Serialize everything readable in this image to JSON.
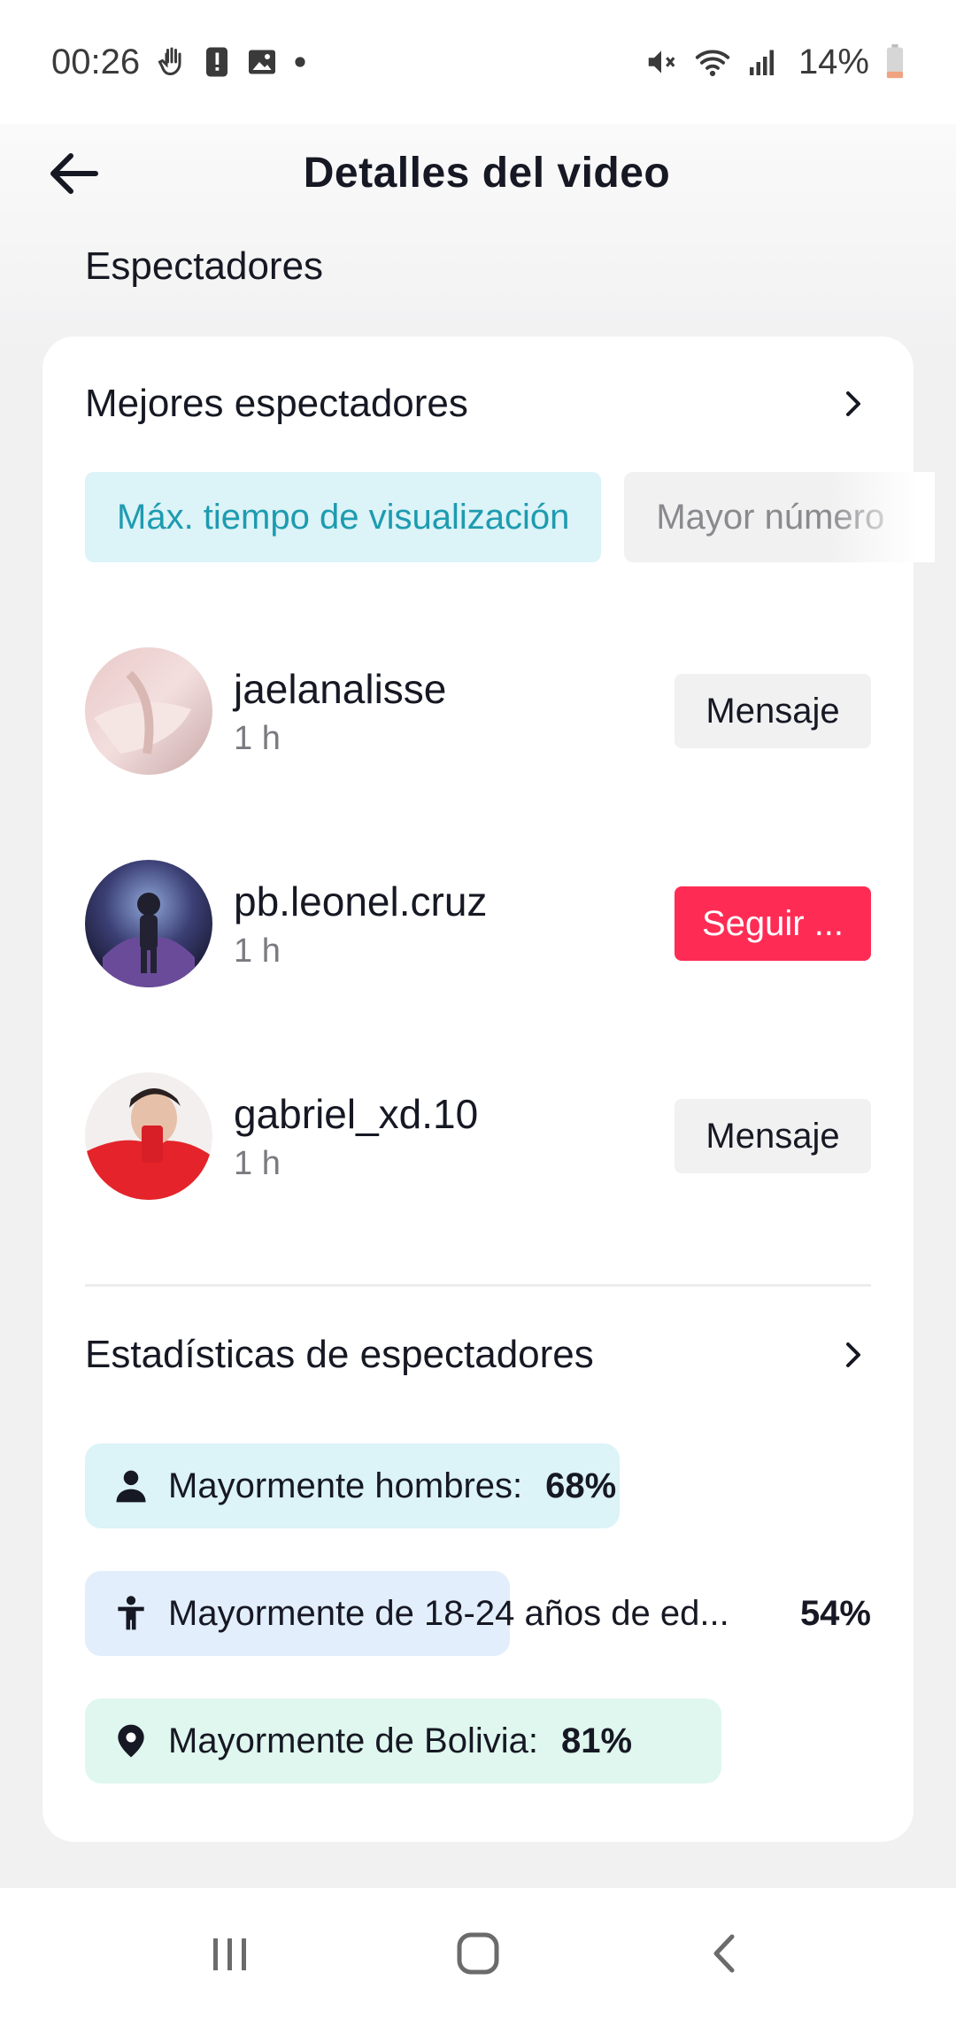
{
  "status_bar": {
    "time": "00:26",
    "battery": "14%",
    "icons": [
      "gesture-icon",
      "alert-icon",
      "image-icon",
      "dot-icon",
      "mute-icon",
      "wifi-icon",
      "signal-icon",
      "battery-icon"
    ]
  },
  "header": {
    "title": "Detalles del video",
    "back_icon": "arrow-left-icon"
  },
  "section_title": "Espectadores",
  "top_viewers": {
    "title": "Mejores espectadores",
    "tabs": [
      {
        "label": "Máx. tiempo de visualización",
        "active": true
      },
      {
        "label": "Mayor número",
        "active": false
      }
    ],
    "viewers": [
      {
        "name": "jaelanalisse",
        "time": "1 h",
        "action": "Mensaje"
      },
      {
        "name": "pb.leonel.cruz",
        "time": "1 h",
        "action": "Seguir ..."
      },
      {
        "name": "gabriel_xd.10",
        "time": "1 h",
        "action": "Mensaje"
      }
    ]
  },
  "viewer_stats": {
    "title": "Estadísticas de espectadores",
    "items": [
      {
        "icon": "person-icon",
        "label": "Mayormente hombres:",
        "value": "68%",
        "fraction": 0.68,
        "color": "#dcf3f7"
      },
      {
        "icon": "child-icon",
        "label": "Mayormente de 18-24 años de ed...",
        "value": "54%",
        "fraction": 0.54,
        "color": "#e2eefb"
      },
      {
        "icon": "location-pin-icon",
        "label": "Mayormente de Bolivia:",
        "value": "81%",
        "fraction": 0.81,
        "color": "#dff7ef"
      }
    ]
  },
  "colors": {
    "accent_teal": "#1d9bb0",
    "follow_red": "#fe2c55"
  },
  "nav_bar": {
    "icons": [
      "recent-apps-icon",
      "home-icon",
      "back-icon"
    ]
  }
}
